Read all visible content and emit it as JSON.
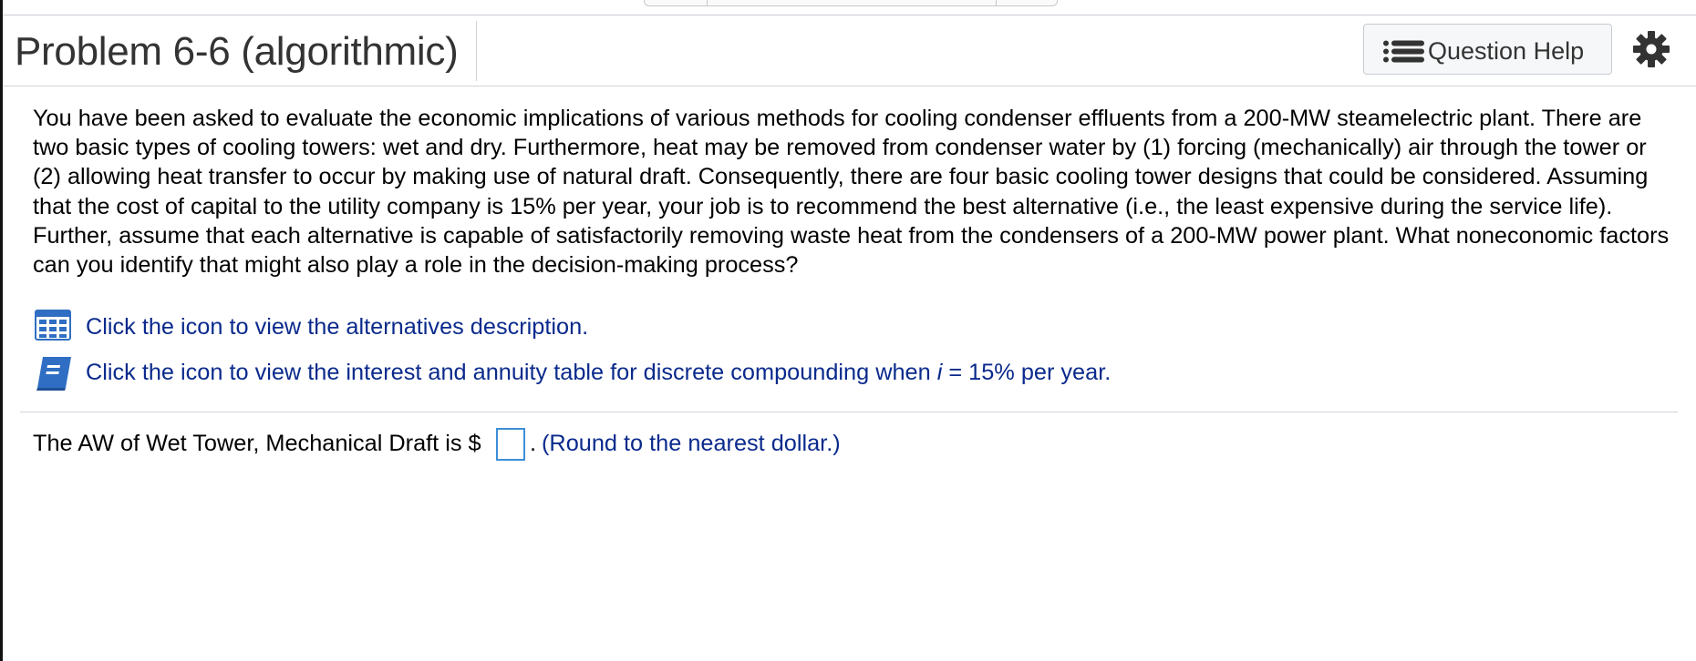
{
  "header": {
    "title": "Problem 6-6 (algorithmic)",
    "help_label": "Question Help"
  },
  "problem": {
    "text": "You have been asked to evaluate the economic implications of various methods for cooling condenser effluents from a 200-MW steamelectric plant. There are two basic types of cooling towers: wet and dry. Furthermore, heat may be removed from condenser water by (1) forcing (mechanically) air through the tower or (2) allowing heat transfer to occur by making use of natural draft. Consequently, there are four basic cooling tower designs that could be considered. Assuming that the cost of capital to the utility company is 15% per year, your job is to recommend the best alternative (i.e., the least expensive during the service life). Further, assume that each alternative is capable of satisfactorily removing waste heat from the condensers of a 200-MW power plant. What noneconomic factors can you identify that might also play a role in the decision-making process?"
  },
  "links": {
    "alternatives": "Click the icon to view the alternatives description.",
    "interest_prefix": "Click the icon to view the interest and annuity table for discrete compounding when ",
    "interest_var": "i",
    "interest_suffix": " = 15% per year."
  },
  "answer": {
    "prefix": "The AW of Wet Tower, Mechanical Draft is $",
    "value": "",
    "after": ".",
    "hint": " (Round to the nearest dollar.)"
  },
  "colors": {
    "link": "#0a2a8c",
    "input_border": "#3d8fd6",
    "icon_blue": "#2f6ec2"
  },
  "icons": [
    "list-icon",
    "gear-icon",
    "table-grid-icon",
    "book-icon"
  ]
}
